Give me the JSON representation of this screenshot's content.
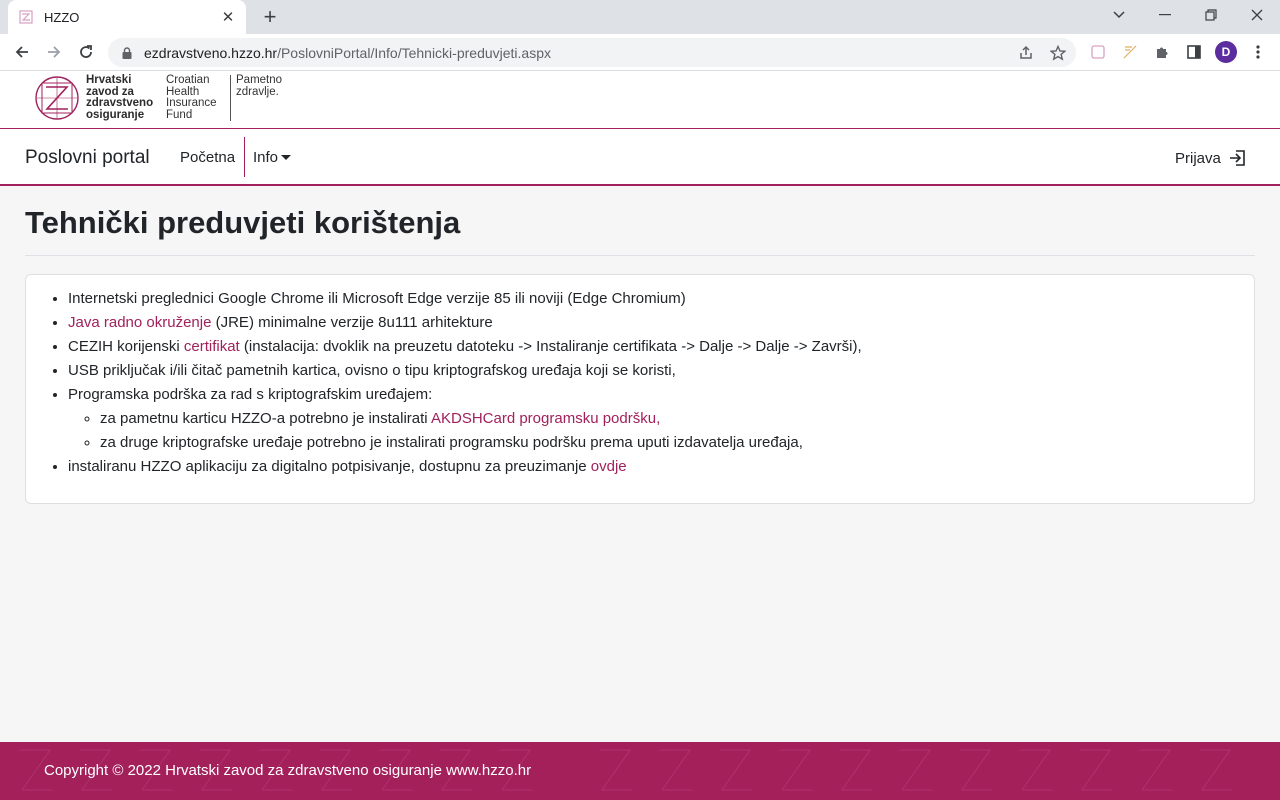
{
  "browser": {
    "tab_title": "HZZO",
    "url_host": "ezdravstveno.hzzo.hr",
    "url_path": "/PoslovniPortal/Info/Tehnicki-preduvjeti.aspx",
    "avatar_letter": "D"
  },
  "header": {
    "logo_hr": [
      "Hrvatski",
      "zavod za",
      "zdravstveno",
      "osiguranje"
    ],
    "logo_en": [
      "Croatian",
      "Health",
      "Insurance",
      "Fund"
    ],
    "logo_slogan": [
      "Pametno",
      "zdravlje."
    ]
  },
  "nav": {
    "brand": "Poslovni portal",
    "home": "Početna",
    "info": "Info",
    "login": "Prijava"
  },
  "page": {
    "title": "Tehnički preduvjeti korištenja",
    "items": {
      "i1": "Internetski preglednici Google Chrome ili Microsoft Edge verzije 85 ili noviji (Edge Chromium)",
      "i2_link": "Java radno okruženje",
      "i2_text": " (JRE) minimalne verzije 8u111 arhitekture",
      "i3_pre": "CEZIH korijenski ",
      "i3_link": "certifikat",
      "i3_post": " (instalacija: dvoklik na preuzetu datoteku -> Instaliranje certifikata -> Dalje -> Dalje -> Završi),",
      "i4": "USB priključak i/ili čitač pametnih kartica, ovisno o tipu kriptografskog uređaja koji se koristi,",
      "i5": "Programska podrška za rad s kriptografskim uređajem:",
      "i5a_pre": "za pametnu karticu HZZO-a potrebno je instalirati ",
      "i5a_link": "AKDSHCard programsku podršku,",
      "i5b": "za druge kriptografske uređaje potrebno je instalirati programsku podršku prema uputi izdavatelja uređaja,",
      "i6_pre": "instaliranu HZZO aplikaciju za digitalno potpisivanje, dostupnu za preuzimanje ",
      "i6_link": "ovdje"
    }
  },
  "footer": {
    "text": "Copyright © 2022 Hrvatski zavod za zdravstveno osiguranje www.hzzo.hr"
  },
  "colors": {
    "accent": "#a0215c",
    "footer_bg": "#a3205b"
  },
  "icons": [
    "favicon-icon",
    "close-icon",
    "plus-icon",
    "back-icon",
    "forward-icon",
    "reload-icon",
    "lock-icon",
    "share-icon",
    "star-icon",
    "puzzle-icon",
    "sidepanel-icon",
    "menu-icon",
    "login-icon"
  ]
}
